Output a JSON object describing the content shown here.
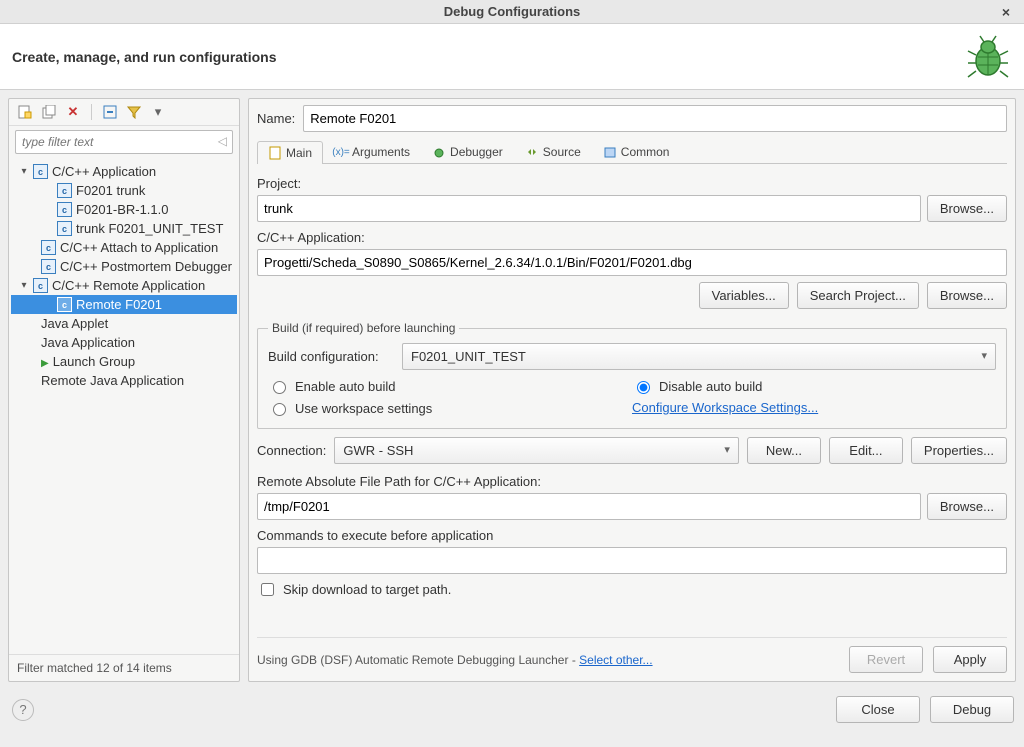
{
  "window": {
    "title": "Debug Configurations"
  },
  "header": {
    "title": "Create, manage, and run configurations"
  },
  "filter": {
    "placeholder": "type filter text"
  },
  "tree": {
    "items": [
      {
        "label": "C/C++ Application"
      },
      {
        "label": "F0201 trunk"
      },
      {
        "label": "F0201-BR-1.1.0"
      },
      {
        "label": "trunk F0201_UNIT_TEST"
      },
      {
        "label": "C/C++ Attach to Application"
      },
      {
        "label": "C/C++ Postmortem Debugger"
      },
      {
        "label": "C/C++ Remote Application"
      },
      {
        "label": "Remote F0201"
      },
      {
        "label": "Java Applet"
      },
      {
        "label": "Java Application"
      },
      {
        "label": "Launch Group"
      },
      {
        "label": "Remote Java Application"
      }
    ]
  },
  "left_footer": "Filter matched 12 of 14 items",
  "name": {
    "label": "Name:",
    "value": "Remote F0201"
  },
  "tabs": {
    "main": "Main",
    "arguments": "Arguments",
    "debugger": "Debugger",
    "source": "Source",
    "common": "Common"
  },
  "main_tab": {
    "project_label": "Project:",
    "project_value": "trunk",
    "app_label": "C/C++ Application:",
    "app_value": "Progetti/Scheda_S0890_S0865/Kernel_2.6.34/1.0.1/Bin/F0201/F0201.dbg",
    "btn_variables": "Variables...",
    "btn_search_project": "Search Project...",
    "btn_browse": "Browse...",
    "build_group_legend": "Build (if required) before launching",
    "build_config_label": "Build configuration:",
    "build_config_value": "F0201_UNIT_TEST",
    "radio_enable_auto": "Enable auto build",
    "radio_disable_auto": "Disable auto build",
    "radio_workspace": "Use workspace settings",
    "link_configure_ws": "Configure Workspace Settings...",
    "connection_label": "Connection:",
    "connection_value": "GWR - SSH",
    "btn_new": "New...",
    "btn_edit": "Edit...",
    "btn_properties": "Properties...",
    "remote_path_label": "Remote Absolute File Path for C/C++ Application:",
    "remote_path_value": "/tmp/F0201",
    "commands_label": "Commands to execute before application",
    "commands_value": "",
    "skip_download_label": "Skip download to target path."
  },
  "right_footer": {
    "text_prefix": "Using GDB (DSF) Automatic Remote Debugging Launcher - ",
    "link": "Select other...",
    "btn_revert": "Revert",
    "btn_apply": "Apply"
  },
  "dialog_footer": {
    "btn_close": "Close",
    "btn_debug": "Debug"
  }
}
